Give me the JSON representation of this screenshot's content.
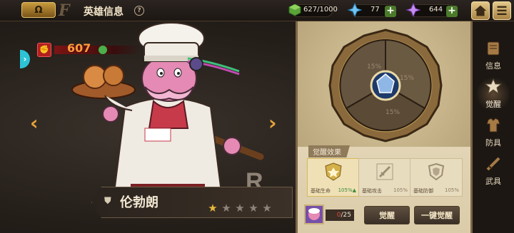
{
  "topbar": {
    "back_label": "Ω",
    "brand_glyph": "F",
    "title": "英雄信息",
    "help": "?",
    "resources": [
      {
        "name": "stamina",
        "icon": "green-cube-icon",
        "value": "627/1000",
        "color": "#5aa43a"
      },
      {
        "name": "gem-blue",
        "icon": "blue-crystal-icon",
        "value": "77",
        "color": "#5fb6e6"
      },
      {
        "name": "gem-purple",
        "icon": "purple-crystal-icon",
        "value": "644",
        "color": "#b86ee6"
      }
    ],
    "plus": "+"
  },
  "hero": {
    "power": "607",
    "name": "伦勃朗",
    "rarity": "R",
    "stars_total": 5,
    "stars_filled": 1,
    "nav_prev": "‹",
    "nav_next": "›",
    "side_tab": "›"
  },
  "awaken": {
    "wheel_percents": [
      "15%",
      "15%",
      "15%"
    ],
    "effect_title": "觉醒效果",
    "effects": [
      {
        "label": "基础生命",
        "pct": "105%",
        "active": true,
        "trend": "▲"
      },
      {
        "label": "基础攻击",
        "pct": "105%",
        "active": false
      },
      {
        "label": "基础防御",
        "pct": "105%",
        "active": false
      }
    ],
    "item_count_cur": "0",
    "item_count_need": "/25",
    "awaken_btn": "觉醒",
    "oneclick_btn": "一键觉醒"
  },
  "nav": [
    {
      "label": "信息",
      "icon": "scroll-icon",
      "active": false
    },
    {
      "label": "觉醒",
      "icon": "awaken-emblem-icon",
      "active": true
    },
    {
      "label": "防具",
      "icon": "armor-icon",
      "active": false
    },
    {
      "label": "武具",
      "icon": "weapon-icon",
      "active": false
    }
  ],
  "colors": {
    "accent": "#e6a43b",
    "panel": "#e3d6b8",
    "dark": "#1c1713"
  }
}
